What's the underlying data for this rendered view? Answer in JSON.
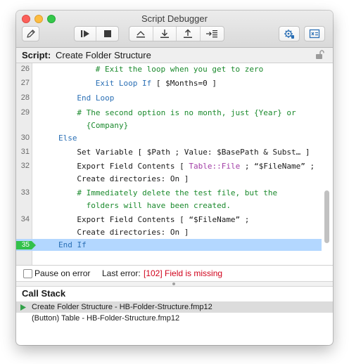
{
  "window": {
    "title": "Script Debugger"
  },
  "toolbar": {
    "edit_icon": "pencil-icon",
    "run_icon": "step-run-icon",
    "halt_icon": "stop-square-icon",
    "step_over_icon": "step-over-icon",
    "step_into_icon": "step-into-icon",
    "step_out_icon": "step-out-icon",
    "set_next_step_icon": "set-next-step-icon",
    "breakpoints_icon": "gear-bug-icon",
    "data_viewer_icon": "data-viewer-icon"
  },
  "script_bar": {
    "label": "Script:",
    "name": "Create Folder Structure",
    "lock_icon": "unlocked-padlock-icon"
  },
  "code_lines": [
    {
      "num": "26",
      "indent": 5,
      "parts": [
        {
          "t": "# Exit the loop when you get to zero",
          "c": "cm"
        }
      ]
    },
    {
      "num": "27",
      "indent": 5,
      "parts": [
        {
          "t": "Exit Loop If",
          "c": "kw"
        },
        {
          "t": " [ $Months=0 ]",
          "c": ""
        }
      ]
    },
    {
      "num": "28",
      "indent": 4,
      "parts": [
        {
          "t": "End Loop",
          "c": "kw"
        }
      ]
    },
    {
      "num": "29",
      "indent": 4,
      "parts": [
        {
          "t": "# The second option is no month, just {Year} or",
          "c": "cm"
        }
      ]
    },
    {
      "num": "",
      "indent": 4,
      "parts": [
        {
          "t": "  {Company}",
          "c": "cm"
        }
      ]
    },
    {
      "num": "30",
      "indent": 3,
      "parts": [
        {
          "t": "Else",
          "c": "kw"
        }
      ]
    },
    {
      "num": "31",
      "indent": 4,
      "parts": [
        {
          "t": "Set Variable [ $Path ; Value: $BasePath & Subst… ]",
          "c": ""
        }
      ]
    },
    {
      "num": "32",
      "indent": 4,
      "parts": [
        {
          "t": "Export Field Contents [ ",
          "c": ""
        },
        {
          "t": "Table::File",
          "c": "mg"
        },
        {
          "t": " ; “$FileName” ;",
          "c": ""
        }
      ]
    },
    {
      "num": "",
      "indent": 4,
      "parts": [
        {
          "t": "Create directories: On ]",
          "c": ""
        }
      ]
    },
    {
      "num": "33",
      "indent": 4,
      "parts": [
        {
          "t": "# Immediately delete the test file, but the",
          "c": "cm"
        }
      ]
    },
    {
      "num": "",
      "indent": 4,
      "parts": [
        {
          "t": "  folders will have been created.",
          "c": "cm"
        }
      ]
    },
    {
      "num": "34",
      "indent": 4,
      "parts": [
        {
          "t": "Export Field Contents [ “$FileName” ;",
          "c": ""
        }
      ]
    },
    {
      "num": "",
      "indent": 4,
      "parts": [
        {
          "t": "Create directories: On ]",
          "c": ""
        }
      ]
    },
    {
      "num": "35",
      "indent": 3,
      "current": true,
      "parts": [
        {
          "t": "End If",
          "c": "kw"
        }
      ]
    }
  ],
  "status": {
    "pause_on_error_label": "Pause on error",
    "pause_on_error_checked": false,
    "last_error_label": "Last error:",
    "last_error_value": "[102] Field is missing"
  },
  "call_stack": {
    "title": "Call Stack",
    "items": [
      {
        "label": "Create Folder Structure - HB-Folder-Structure.fmp12",
        "active": true
      },
      {
        "label": "(Button) Table - HB-Folder-Structure.fmp12",
        "active": false
      }
    ]
  },
  "colors": {
    "keyword": "#2a6fb5",
    "comment": "#1b8a2d",
    "field_ref": "#a23ea6",
    "error": "#d0021b",
    "current_line": "#b3d7ff",
    "breakpoint_marker": "#33c14a"
  }
}
